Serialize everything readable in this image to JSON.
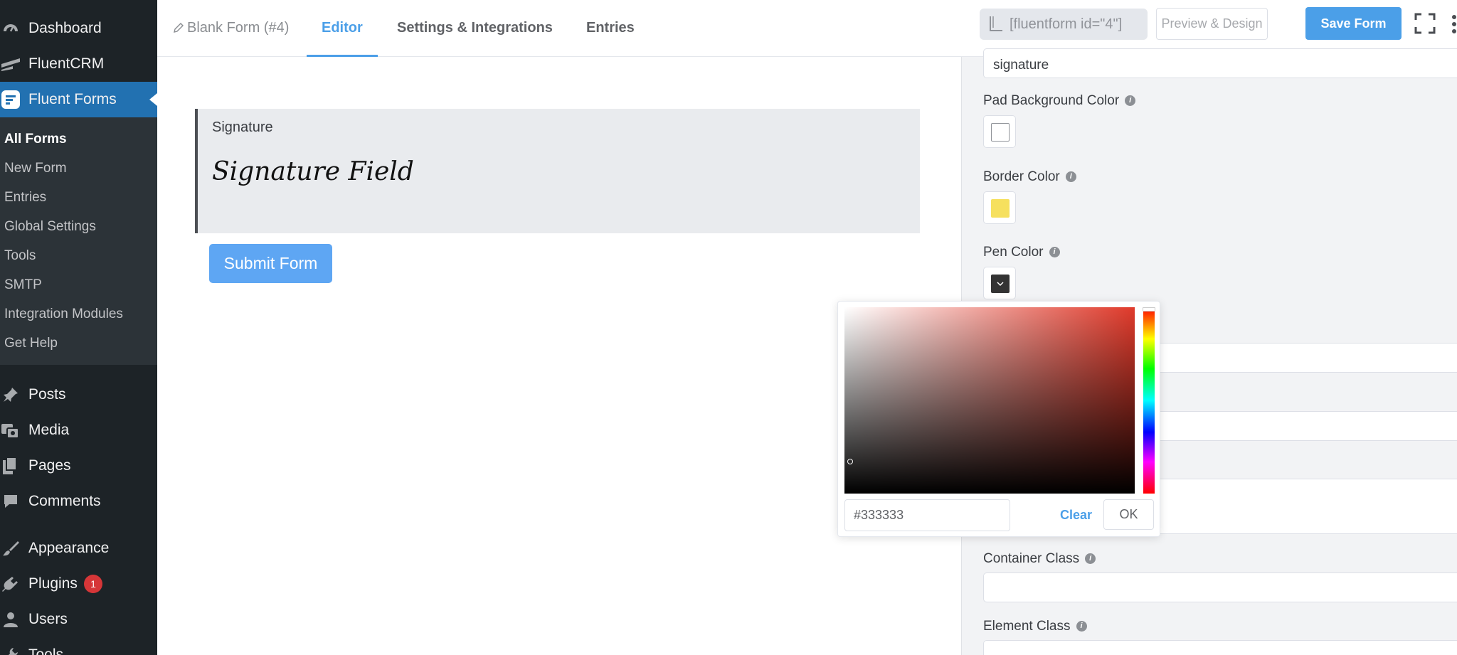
{
  "sidebar": {
    "top_items": [
      {
        "label": "Dashboard",
        "icon": "dashboard-icon"
      },
      {
        "label": "FluentCRM",
        "icon": "fluentcrm-icon"
      },
      {
        "label": "Fluent Forms",
        "icon": "fluent-forms-icon"
      }
    ],
    "submenu": [
      "All Forms",
      "New Form",
      "Entries",
      "Global Settings",
      "Tools",
      "SMTP",
      "Integration Modules",
      "Get Help"
    ],
    "bottom_items": [
      {
        "label": "Posts",
        "icon": "pin-icon"
      },
      {
        "label": "Media",
        "icon": "media-icon"
      },
      {
        "label": "Pages",
        "icon": "pages-icon"
      },
      {
        "label": "Comments",
        "icon": "comment-icon"
      },
      {
        "label": "Appearance",
        "icon": "brush-icon"
      },
      {
        "label": "Plugins",
        "icon": "plugin-icon",
        "badge": "1"
      },
      {
        "label": "Users",
        "icon": "user-icon"
      },
      {
        "label": "Tools",
        "icon": "wrench-icon"
      }
    ]
  },
  "topbar": {
    "breadcrumb": "Blank Form (#4)",
    "tabs": [
      "Editor",
      "Settings & Integrations",
      "Entries"
    ],
    "shortcode": "[fluentform id=\"4\"]",
    "preview_label": "Preview & Design",
    "save_label": "Save Form"
  },
  "canvas": {
    "field_label": "Signature",
    "signature_text": "Signature Field",
    "submit_label": "Submit Form"
  },
  "panel": {
    "name_value": "signature",
    "pad_bg_label": "Pad Background Color",
    "border_label": "Border Color",
    "pen_label": "Pen Color",
    "container_label": "Container Class",
    "element_label": "Element Class",
    "colors": {
      "pad_bg": "#ffffff",
      "border": "#f6e05e",
      "pen": "#333333"
    }
  },
  "picker": {
    "hex_value": "#333333",
    "clear_label": "Clear",
    "ok_label": "OK"
  }
}
